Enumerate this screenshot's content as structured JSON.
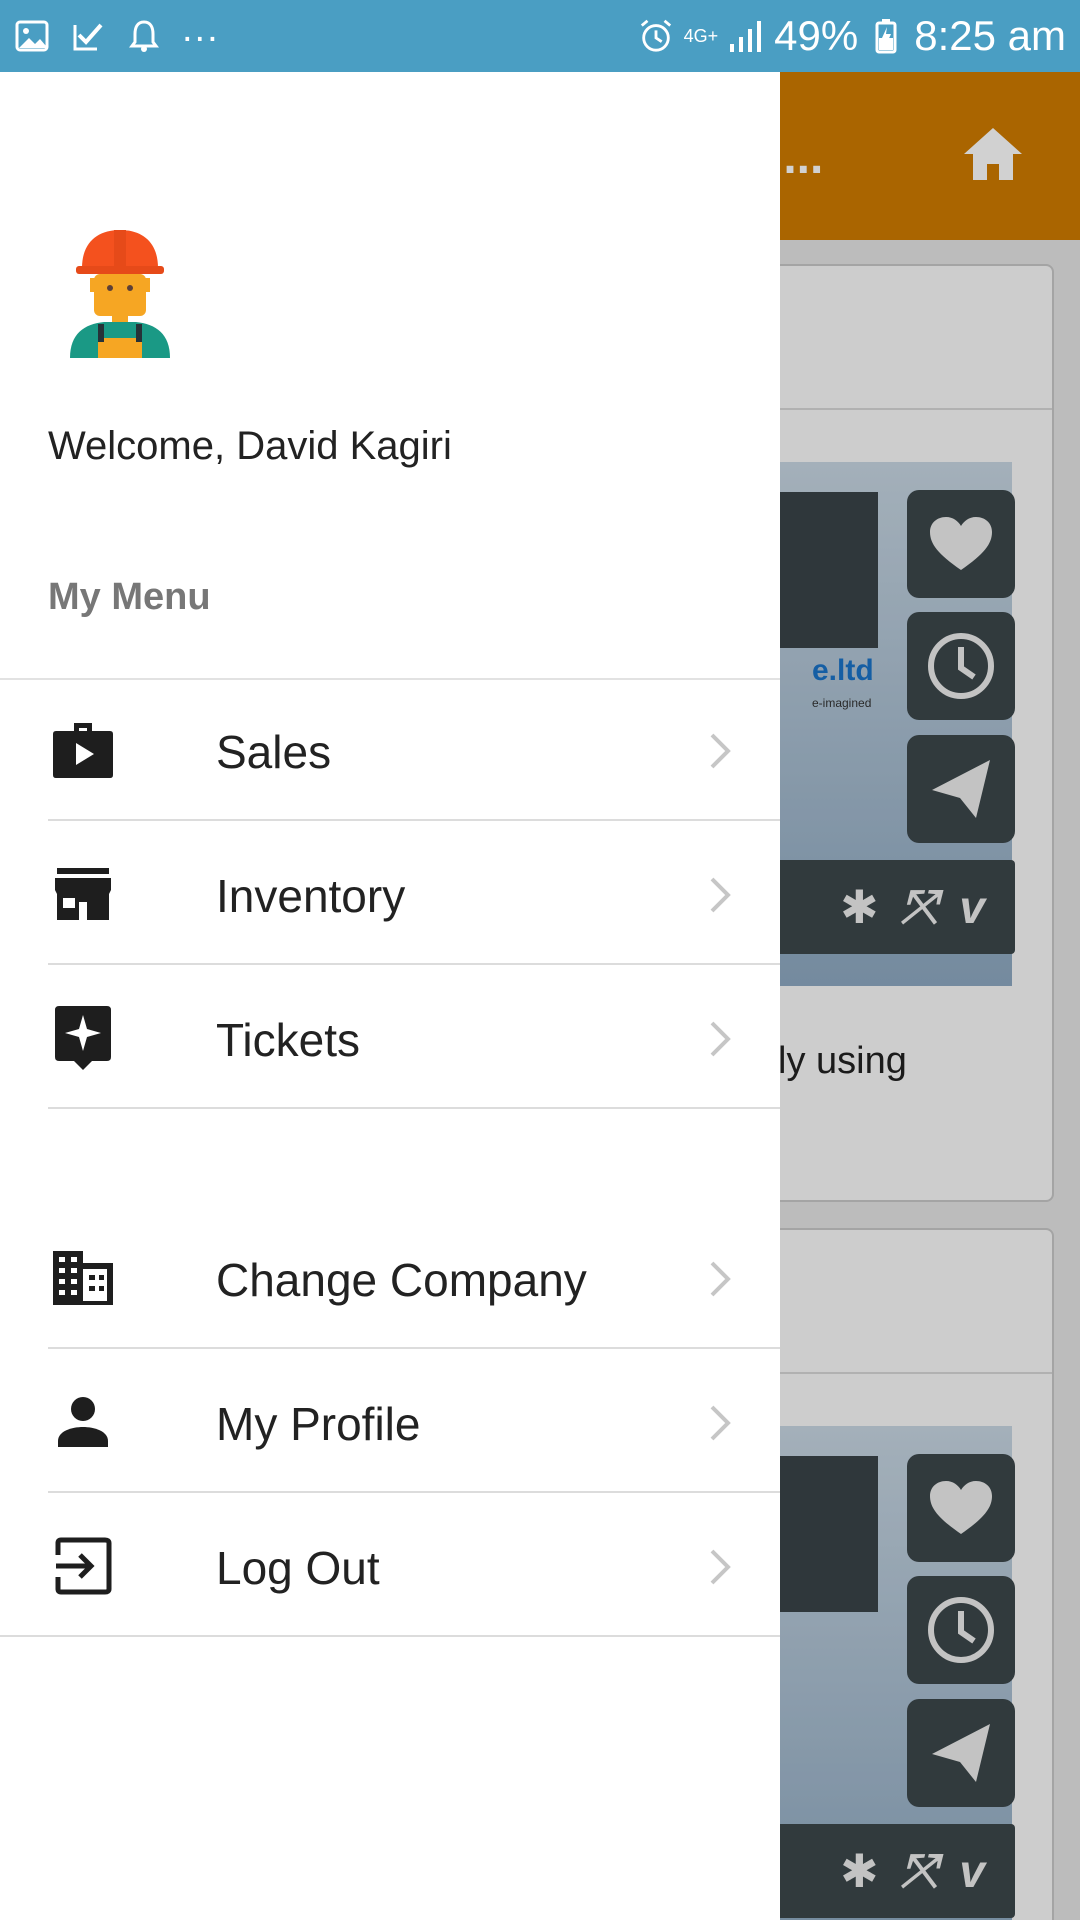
{
  "status_bar": {
    "battery": "49%",
    "time": "8:25 am",
    "network": "4G+"
  },
  "background": {
    "appbar_title": "l...",
    "card_text": "ly using",
    "logo_text": "e.ltd",
    "logo_sub": "e-imagined",
    "accent_color": "#d07c00"
  },
  "drawer": {
    "welcome": "Welcome, David Kagiri",
    "menu_heading": "My Menu",
    "items": [
      {
        "label": "Sales",
        "icon": "briefcase-play-icon"
      },
      {
        "label": "Inventory",
        "icon": "store-icon"
      },
      {
        "label": "Tickets",
        "icon": "tickets-star-icon"
      },
      {
        "label": "Change Company",
        "icon": "building-icon"
      },
      {
        "label": "My Profile",
        "icon": "person-icon"
      },
      {
        "label": "Log Out",
        "icon": "logout-icon"
      }
    ]
  }
}
